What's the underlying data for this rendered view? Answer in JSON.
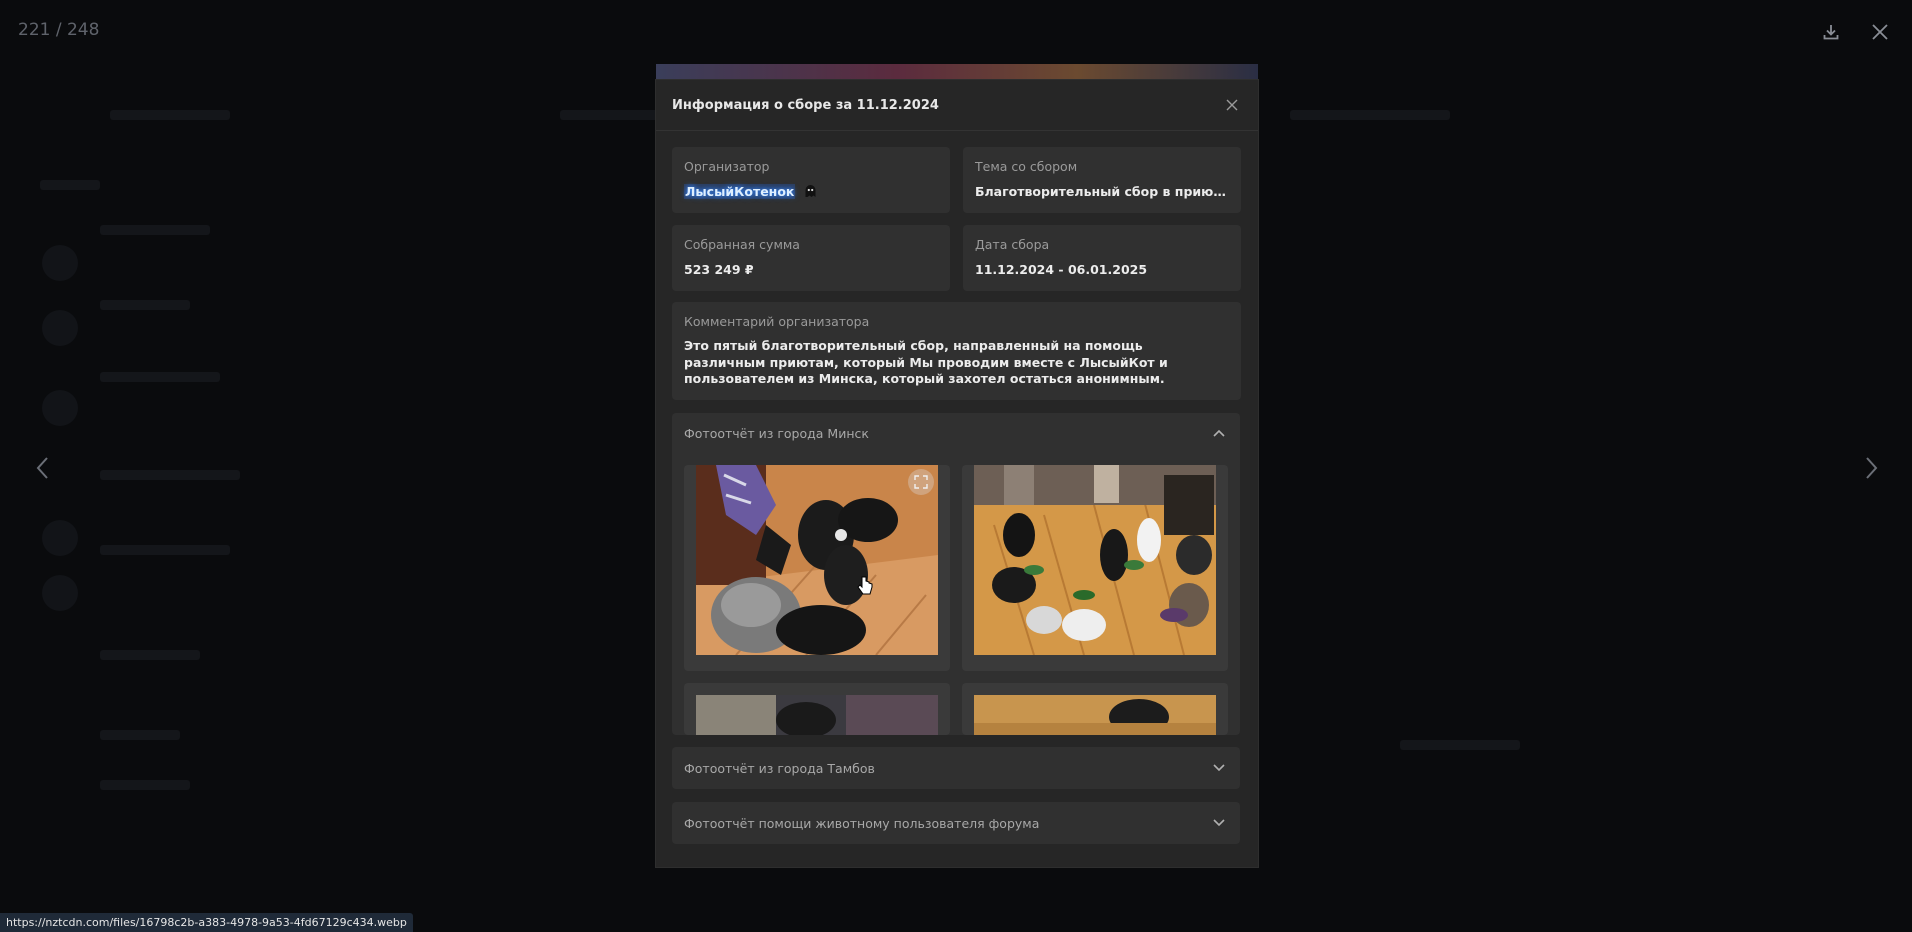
{
  "viewer": {
    "counter": "221 / 248",
    "download_icon": "download-icon",
    "close_icon": "close-icon",
    "prev_icon": "chevron-left-icon",
    "next_icon": "chevron-right-icon"
  },
  "modal": {
    "title": "Информация о сборе за 11.12.2024",
    "close_icon": "close-icon",
    "organizer": {
      "label": "Организатор",
      "value": "ЛысыйКотенок",
      "badge_icon": "ghost-icon"
    },
    "topic": {
      "label": "Тема со сбором",
      "value": "Благотворительный сбор в приюты ..."
    },
    "amount": {
      "label": "Собранная сумма",
      "value": "523 249 ₽"
    },
    "date": {
      "label": "Дата сбора",
      "value": "11.12.2024 - 06.01.2025"
    },
    "comment": {
      "label": "Комментарий организатора",
      "text": "Это пятый благотворительный сбор, направленный на помощь различным приютам, который Мы проводим вместе с ЛысыйКот и пользователем из Минска, который захотел остаться анонимным."
    },
    "sections": [
      {
        "title": "Фотоотчёт из города Минск",
        "expanded": true,
        "icon": "chevron-up-icon"
      },
      {
        "title": "Фотоотчёт из города Тамбов",
        "expanded": false,
        "icon": "chevron-down-icon"
      },
      {
        "title": "Фотоотчёт помощи животному пользователя форума",
        "expanded": false,
        "icon": "chevron-down-icon"
      }
    ],
    "photos": [
      {
        "name": "photo-dogs",
        "icon": "expand-icon"
      },
      {
        "name": "photo-cats-feeding"
      },
      {
        "name": "photo-3"
      },
      {
        "name": "photo-4"
      }
    ]
  },
  "status_bar": {
    "url": "https://nztcdn.com/files/16798c2b-a383-4978-9a53-4fd67129c434.webp"
  },
  "colors": {
    "backdrop": "#0a0b0d",
    "modal_bg": "#262626",
    "card_bg": "#303030",
    "organizer_glow": "#3b8cff"
  }
}
